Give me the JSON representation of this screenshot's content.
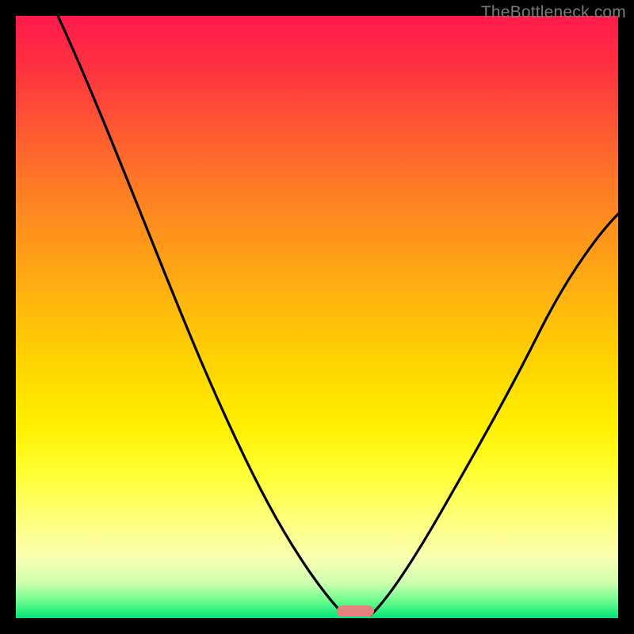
{
  "watermark": "TheBottleneck.com",
  "colors": {
    "background": "#000000",
    "curve": "#000000",
    "marker": "#e98080"
  },
  "chart_data": {
    "type": "line",
    "title": "",
    "xlabel": "",
    "ylabel": "",
    "xlim": [
      0,
      100
    ],
    "ylim": [
      0,
      100
    ],
    "grid": false,
    "legend": false,
    "series": [
      {
        "name": "left-curve",
        "x": [
          7,
          10,
          15,
          20,
          25,
          30,
          35,
          40,
          45,
          50,
          53,
          54.5
        ],
        "values": [
          100,
          94,
          84,
          74,
          63,
          51,
          40,
          29,
          19,
          9,
          3,
          0.5
        ]
      },
      {
        "name": "right-curve",
        "x": [
          59,
          62,
          68,
          74,
          80,
          86,
          92,
          98,
          100
        ],
        "values": [
          0.5,
          3,
          11,
          21,
          32,
          43,
          54,
          64,
          67
        ]
      }
    ],
    "marker": {
      "x_center": 56.5,
      "width_pct": 6.2,
      "y": 0.8
    }
  }
}
